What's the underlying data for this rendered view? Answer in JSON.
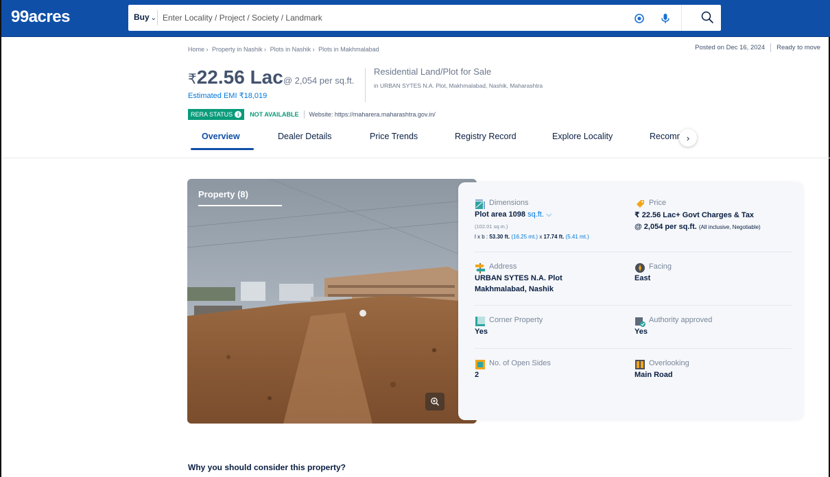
{
  "header": {
    "logo": "99acres",
    "buy_label": "Buy",
    "search_placeholder": "Enter Locality / Project / Society / Landmark"
  },
  "breadcrumb": [
    "Home ›",
    "Property in Nashik ›",
    "Plots in Nashik ›",
    "Plots in Makhmalabad"
  ],
  "posted": {
    "date": "Posted on Dec 16, 2024",
    "status": "Ready to move"
  },
  "price": {
    "currency": "₹",
    "amount": "22.56 Lac",
    "per_sqft": "@ 2,054 per sq.ft.",
    "emi": "Estimated EMI ₹18,019"
  },
  "property": {
    "type": "Residential Land/Plot for Sale",
    "location": "in URBAN SYTES N.A. Plot, Makhmalabad, Nashik, Maharashtra"
  },
  "rera": {
    "badge": "RERA STATUS",
    "status": "NOT AVAILABLE",
    "website": "Website: https://maharera.maharashtra.gov.in/"
  },
  "tabs": [
    "Overview",
    "Dealer Details",
    "Price Trends",
    "Registry Record",
    "Explore Locality",
    "Recomm"
  ],
  "photo": {
    "title": "Property (8)"
  },
  "details": {
    "dimensions": {
      "label": "Dimensions",
      "area_prefix": "Plot area 1098",
      "unit": "sq.ft.",
      "sqm": "(102.01 sq.m.)",
      "lxb_prefix": "l x b :",
      "length_ft": "53.30 ft.",
      "length_m": "(16.25 mt.)",
      "x": "x",
      "breadth_ft": "17.74 ft.",
      "breadth_m": "(5.41 mt.)"
    },
    "price": {
      "label": "Price",
      "line1": "₹ 22.56 Lac+ Govt Charges & Tax",
      "line2": "@ 2,054 per sq.ft.",
      "line2_note": "(All inclusive, Negotiable)"
    },
    "address": {
      "label": "Address",
      "line1": "URBAN SYTES N.A. Plot",
      "line2": "Makhmalabad, Nashik"
    },
    "facing": {
      "label": "Facing",
      "value": "East"
    },
    "corner": {
      "label": "Corner Property",
      "value": "Yes"
    },
    "authority": {
      "label": "Authority approved",
      "value": "Yes"
    },
    "open_sides": {
      "label": "No. of Open Sides",
      "value": "2"
    },
    "overlooking": {
      "label": "Overlooking",
      "value": "Main Road"
    }
  },
  "why_heading": "Why you should consider this property?",
  "colors": {
    "brand": "#0f4fa8",
    "rera": "#0a9b7a",
    "link": "#0078db"
  }
}
